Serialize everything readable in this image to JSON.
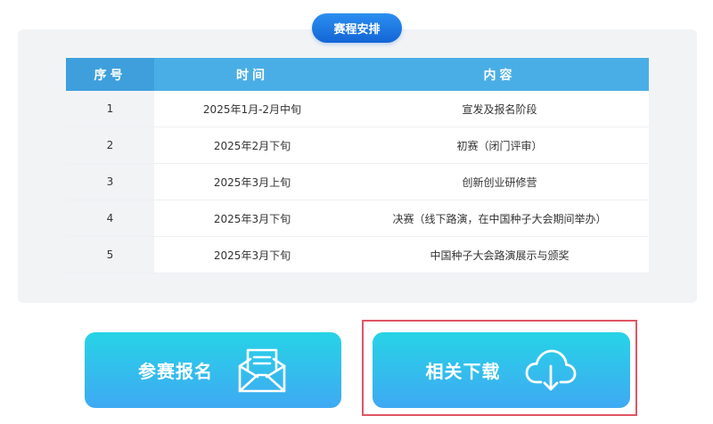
{
  "section": {
    "badge": "赛程安排"
  },
  "table": {
    "headers": [
      "序号",
      "时间",
      "内容"
    ],
    "rows": [
      {
        "no": "1",
        "time": "2025年1月-2月中旬",
        "content": "宣发及报名阶段"
      },
      {
        "no": "2",
        "time": "2025年2月下旬",
        "content": "初赛（闭门评审）"
      },
      {
        "no": "3",
        "time": "2025年3月上旬",
        "content": "创新创业研修营"
      },
      {
        "no": "4",
        "time": "2025年3月下旬",
        "content": "决赛（线下路演，在中国种子大会期间举办）"
      },
      {
        "no": "5",
        "time": "2025年3月下旬",
        "content": "中国种子大会路演展示与颁奖"
      }
    ]
  },
  "actions": {
    "register_label": "参赛报名",
    "register_icon": "envelope-icon",
    "download_label": "相关下载",
    "download_icon": "cloud-download-icon"
  },
  "colors": {
    "badge": "#1a73e0",
    "table_header": "#4aaee6",
    "button_top": "#27d3e6",
    "button_bottom": "#3fa9f3",
    "highlight": "#e05562"
  }
}
